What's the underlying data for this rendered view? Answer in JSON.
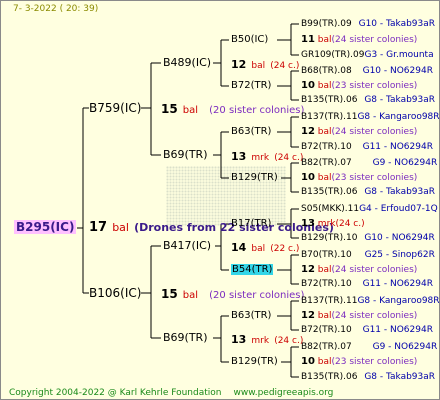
{
  "header": {
    "date": "7-  3-2022 ( 20: 39)"
  },
  "root": {
    "label": "B295(IC)",
    "count": "17",
    "unit": "bal",
    "note": "(Drones from 22 sister colonies)"
  },
  "gen1": [
    {
      "label": "B759(IC)",
      "count": "15",
      "unit": "bal",
      "sisters": "(20 sister colonies)"
    },
    {
      "label": "B106(IC)",
      "count": "15",
      "unit": "bal",
      "sisters": "(20 sister colonies)"
    }
  ],
  "gen2": [
    {
      "label": "B489(IC)",
      "count": "12",
      "unit": "bal",
      "sisters": "(24 c.)"
    },
    {
      "label": "B69(TR)",
      "count": "13",
      "unit": "mrk",
      "sisters": "(24 c.)"
    },
    {
      "label": "B417(IC)",
      "count": "14",
      "unit": "bal",
      "sisters": "(22 c.)"
    },
    {
      "label": "B69(TR)",
      "count": "13",
      "unit": "mrk",
      "sisters": "(24 c.)"
    }
  ],
  "gen3": [
    {
      "label": "B50(IC)"
    },
    {
      "label": "B72(TR)"
    },
    {
      "label": "B63(TR)"
    },
    {
      "label": "B129(TR)"
    },
    {
      "label": "B17(TR)"
    },
    {
      "label": "B54(TR)"
    },
    {
      "label": "B63(TR)"
    },
    {
      "label": "B129(TR)"
    }
  ],
  "gen3_drones": [
    {
      "count": "11",
      "unit": "bal",
      "sisters": "(24 sister colonies)"
    },
    {
      "count": "10",
      "unit": "bal",
      "sisters": "(23 sister colonies)"
    },
    {
      "count": "12",
      "unit": "bal",
      "sisters": "(24 sister colonies)"
    },
    {
      "count": "10",
      "unit": "bal",
      "sisters": "(23 sister colonies)"
    },
    {
      "count": "13",
      "unit": "mrk",
      "sisters": "(24 c.)"
    },
    {
      "count": "12",
      "unit": "bal",
      "sisters": "(24 sister colonies)"
    },
    {
      "count": "12",
      "unit": "bal",
      "sisters": "(24 sister colonies)"
    },
    {
      "count": "10",
      "unit": "bal",
      "sisters": "(23 sister colonies)"
    }
  ],
  "gen4": [
    {
      "id": "B99(TR).09",
      "line": "G10 - Takab93aR"
    },
    {
      "id": "GR109(TR).09",
      "line": "G3 - Gr.mounta"
    },
    {
      "id": "B68(TR).08",
      "line": "G10 - NO6294R"
    },
    {
      "id": "B135(TR).06",
      "line": "G8 - Takab93aR"
    },
    {
      "id": "B137(TR).11",
      "line": "G8 - Kangaroo98R"
    },
    {
      "id": "B72(TR).10",
      "line": "G11 - NO6294R"
    },
    {
      "id": "B82(TR).07",
      "line": "G9 - NO6294R"
    },
    {
      "id": "B135(TR).06",
      "line": "G8 - Takab93aR"
    },
    {
      "id": "S05(MKK).11",
      "line": "G4 - Erfoud07-1Q"
    },
    {
      "id": "B129(TR).10",
      "line": "G10 - NO6294R"
    },
    {
      "id": "B70(TR).10",
      "line": "G25 - Sinop62R"
    },
    {
      "id": "B72(TR).10",
      "line": "G11 - NO6294R"
    },
    {
      "id": "B137(TR).11",
      "line": "G8 - Kangaroo98R"
    },
    {
      "id": "B72(TR).10",
      "line": "G11 - NO6294R"
    },
    {
      "id": "B82(TR).07",
      "line": "G9 - NO6294R"
    },
    {
      "id": "B135(TR).06",
      "line": "G8 - Takab93aR"
    }
  ],
  "footer": {
    "copyright": "Copyright 2004-2022 @ Karl Kehrle Foundation",
    "url": "www.pedigreeapis.org"
  },
  "colors": {
    "background": "#ffffe0",
    "root_bg": "#ffc0ff",
    "highlight": "#33d6e8",
    "lines": "#000000",
    "line_color": "#0000aa",
    "unit_color": "#cc0000"
  }
}
